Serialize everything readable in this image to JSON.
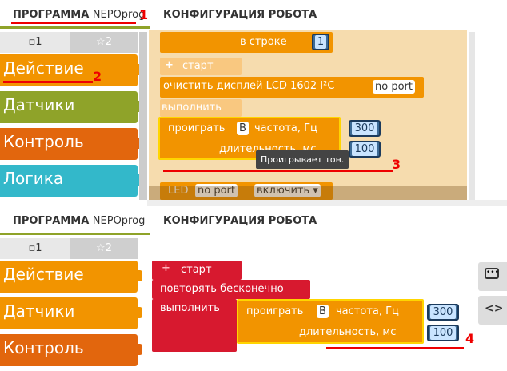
{
  "tabs": {
    "program_label": "ПРОГРАММА",
    "program_name": "NEPOprog",
    "config_label": "КОНФИГУРАЦИЯ РОБОТА"
  },
  "toolbox": {
    "level1": "1",
    "level2": "2",
    "categories": [
      "Действие",
      "Датчики",
      "Контроль",
      "Логика"
    ]
  },
  "top": {
    "in_line": "в строке",
    "in_line_value": "1",
    "start": "старт",
    "clear_display": "очистить дисплей  LCD 1602 I²C",
    "no_port": "no port",
    "execute": "выполнить",
    "play_label": "проиграть",
    "play_var": "B",
    "freq_label": "частота, Гц",
    "freq_value": "300",
    "dur_label": "длительность, мс",
    "dur_value": "100",
    "tooltip": "Проигрывает тон.",
    "led_label": "LED",
    "led_port": "no port",
    "led_state": "включить"
  },
  "bottom": {
    "start": "старт",
    "repeat": "повторять бесконечно",
    "execute": "выполнить",
    "play_label": "проиграть",
    "play_var": "B",
    "freq_label": "частота, Гц",
    "freq_value": "300",
    "dur_label": "длительность, мс",
    "dur_value": "100"
  },
  "annotations": {
    "a1": "1",
    "a2": "2",
    "a3": "3",
    "a4": "4"
  },
  "colors": {
    "orange": "#f29400",
    "green": "#8fa329",
    "red_cat": "#e2660d",
    "teal": "#33b8ca",
    "start_red": "#d7192f",
    "num_blue": "#3d6b96"
  }
}
